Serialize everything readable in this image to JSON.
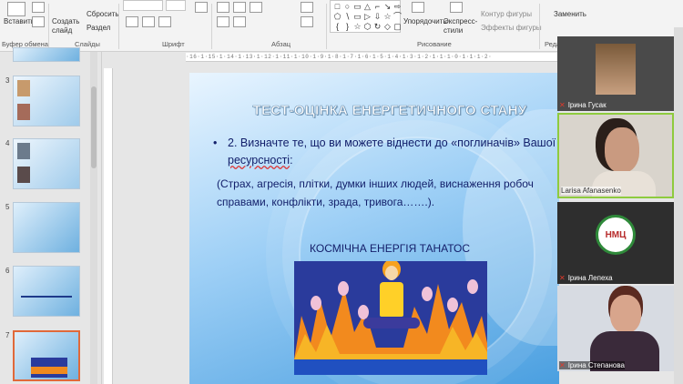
{
  "ribbon": {
    "insert_label": "Вставить",
    "create_slide_label": "Создать слайд",
    "reset_label": "Сбросить",
    "section_label": "Раздел",
    "clipboard_group": "Буфер обмена",
    "slides_group": "Слайды",
    "font_group": "Шрифт",
    "paragraph_group": "Абзац",
    "drawing_group": "Рисование",
    "arrange_label": "Упорядочить",
    "express_styles_label": "Экспресс-стили",
    "shape_outline_label": "Контур фигуры",
    "shape_effects_label": "Эффекты фигуры",
    "replace_label": "Заменить",
    "editing_group": "Реда",
    "shape_glyphs": [
      "□",
      "○",
      "▭",
      "△",
      "⌐",
      "↘",
      "⇨",
      "⬠",
      "∖",
      "▭",
      "▷",
      "⇩",
      "☆",
      "⌒",
      "{",
      "}",
      "☆",
      "⬡",
      "↻",
      "◇",
      "▢"
    ]
  },
  "ruler": "·16·1·15·1·14·1·13·1·12·1·11·1·10·1·9·1·8·1·7·1·6·1·5·1·4·1·3·1·2·1·1·1·0·1·1·1·2·",
  "slide_panel": {
    "thumbs": [
      {
        "num": "3"
      },
      {
        "num": "4"
      },
      {
        "num": "5"
      },
      {
        "num": "6"
      },
      {
        "num": "7"
      }
    ]
  },
  "slide": {
    "title": "ТЕСТ-ОЦІНКА ЕНЕРГЕТИЧНОГО СТАНУ",
    "bullet_marker": "•",
    "bullet_text_1": "2. Визначте те, що ви можете віднести до «поглиначів» Вашої",
    "bullet_text_2": "ресурсності",
    "bullet_text_3": ":",
    "paren_line_1": "(Страх, агресія, плітки, думки інших людей, виснаження робоч",
    "paren_line_2": "справами, конфлікти, зрада, тривога…….).",
    "subheading": "КОСМІЧНА ЕНЕРГІЯ ТАНАТОС"
  },
  "participants": [
    {
      "name": "Ірина Гусак"
    },
    {
      "name": "Larisa Afanasenko"
    },
    {
      "name": "Ірина Лепеха",
      "logo_text": "НМЦ"
    },
    {
      "name": "Ірина Степанова"
    }
  ]
}
